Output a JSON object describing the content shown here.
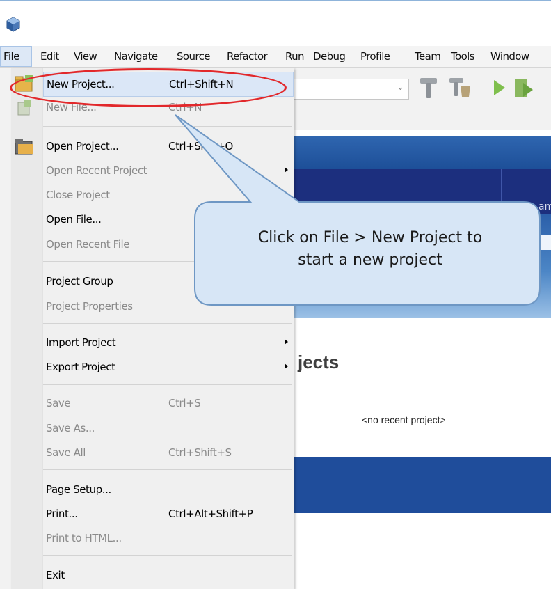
{
  "menubar": {
    "items": [
      "File",
      "Edit",
      "View",
      "Navigate",
      "Source",
      "Refactor",
      "Run",
      "Debug",
      "Profile",
      "Team",
      "Tools",
      "Window"
    ]
  },
  "file_menu": {
    "new_project": {
      "label": "New Project...",
      "shortcut": "Ctrl+Shift+N"
    },
    "new_file": {
      "label": "New File...",
      "shortcut": "Ctrl+N"
    },
    "open_project": {
      "label": "Open Project...",
      "shortcut": "Ctrl+Shift+O"
    },
    "open_recent_project": {
      "label": "Open Recent Project"
    },
    "close_project": {
      "label": "Close Project"
    },
    "open_file": {
      "label": "Open File..."
    },
    "open_recent_file": {
      "label": "Open Recent File"
    },
    "project_group": {
      "label": "Project Group"
    },
    "project_properties": {
      "label": "Project Properties"
    },
    "import_project": {
      "label": "Import Project"
    },
    "export_project": {
      "label": "Export Project"
    },
    "save": {
      "label": "Save",
      "shortcut": "Ctrl+S"
    },
    "save_as": {
      "label": "Save As..."
    },
    "save_all": {
      "label": "Save All",
      "shortcut": "Ctrl+Shift+S"
    },
    "page_setup": {
      "label": "Page Setup..."
    },
    "print": {
      "label": "Print...",
      "shortcut": "Ctrl+Alt+Shift+P"
    },
    "print_to_html": {
      "label": "Print to HTML..."
    },
    "exit": {
      "label": "Exit"
    }
  },
  "start_page": {
    "projects_heading": "jects",
    "no_recent": "<no recent project>",
    "tab_fragment": "am"
  },
  "callout": {
    "line1": "Click on File > New Project to",
    "line2": "start a new project"
  },
  "colors": {
    "highlight_ring": "#e2282b",
    "callout_fill": "#d7e6f6",
    "callout_border": "#6e97c4",
    "menu_selection": "#dbe7f7"
  },
  "icons": [
    "app-icon",
    "new-project-icon",
    "new-file-icon",
    "open-project-icon",
    "hammer-icon",
    "clean-build-icon",
    "run-icon",
    "debug-icon"
  ]
}
